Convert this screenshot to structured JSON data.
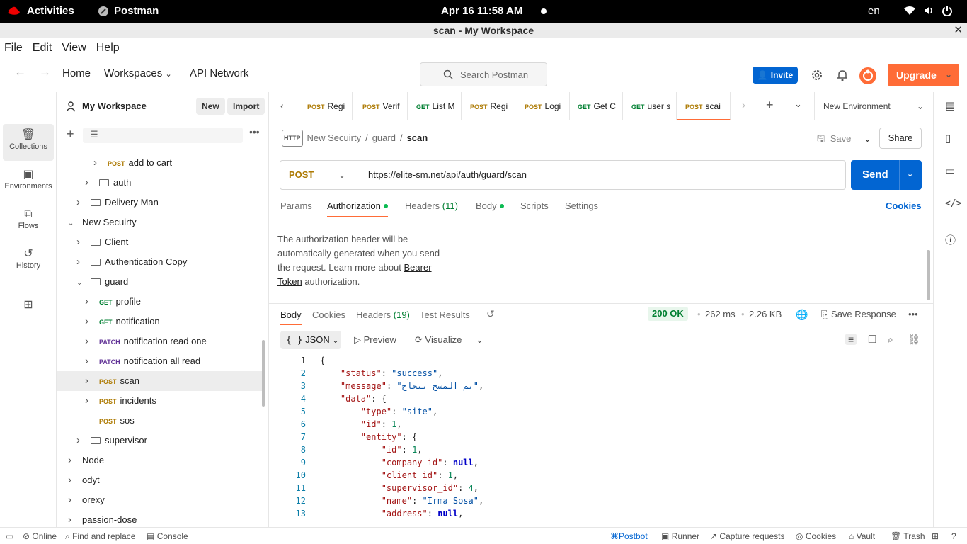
{
  "system": {
    "activities": "Activities",
    "app_name": "Postman",
    "clock": "Apr 16  11:58 AM",
    "lang": "en"
  },
  "window": {
    "title": "scan - My Workspace"
  },
  "menu": [
    "File",
    "Edit",
    "View",
    "Help"
  ],
  "header": {
    "home": "Home",
    "workspaces": "Workspaces",
    "api_network": "API Network",
    "search_placeholder": "Search Postman",
    "invite": "Invite",
    "upgrade": "Upgrade"
  },
  "rail": [
    {
      "label": "Collections",
      "icon": "collections-icon"
    },
    {
      "label": "Environments",
      "icon": "environments-icon"
    },
    {
      "label": "Flows",
      "icon": "flows-icon"
    },
    {
      "label": "History",
      "icon": "history-icon"
    }
  ],
  "sidebar": {
    "workspace_name": "My Workspace",
    "new_label": "New",
    "import_label": "Import",
    "tree": [
      {
        "indent": 3,
        "chev": true,
        "method": "POST",
        "label": "add to cart"
      },
      {
        "indent": 2,
        "chev": true,
        "folder": true,
        "label": "auth"
      },
      {
        "indent": 1,
        "chev": true,
        "folder": true,
        "label": "Delivery Man"
      },
      {
        "indent": 0,
        "chev": true,
        "open": true,
        "label": "New Secuirty"
      },
      {
        "indent": 1,
        "chev": true,
        "folder": true,
        "label": "Client"
      },
      {
        "indent": 1,
        "chev": true,
        "folder": true,
        "label": "Authentication Copy"
      },
      {
        "indent": 1,
        "chev": true,
        "open": true,
        "folder": true,
        "label": "guard"
      },
      {
        "indent": 2,
        "chev": true,
        "method": "GET",
        "label": "profile"
      },
      {
        "indent": 2,
        "chev": true,
        "method": "GET",
        "label": "notification"
      },
      {
        "indent": 2,
        "chev": true,
        "method": "PATCH",
        "label": "notification read one"
      },
      {
        "indent": 2,
        "chev": true,
        "method": "PATCH",
        "label": "notification all read"
      },
      {
        "indent": 2,
        "chev": true,
        "method": "POST",
        "label": "scan",
        "selected": true
      },
      {
        "indent": 2,
        "chev": true,
        "method": "POST",
        "label": "incidents"
      },
      {
        "indent": 2,
        "chev": false,
        "method": "POST",
        "label": "sos"
      },
      {
        "indent": 1,
        "chev": true,
        "folder": true,
        "label": "supervisor"
      },
      {
        "indent": 0,
        "chev": true,
        "label": "Node"
      },
      {
        "indent": 0,
        "chev": true,
        "label": "odyt"
      },
      {
        "indent": 0,
        "chev": true,
        "label": "orexy"
      },
      {
        "indent": 0,
        "chev": true,
        "label": "passion-dose"
      }
    ]
  },
  "tabs": [
    {
      "method": "POST",
      "label": "Regi"
    },
    {
      "method": "POST",
      "label": "Verif"
    },
    {
      "method": "GET",
      "label": "List M"
    },
    {
      "method": "POST",
      "label": "Regi"
    },
    {
      "method": "POST",
      "label": "Logi"
    },
    {
      "method": "GET",
      "label": "Get C"
    },
    {
      "method": "GET",
      "label": "user s"
    },
    {
      "method": "POST",
      "label": "scai",
      "active": true
    }
  ],
  "environment": "New Environment",
  "request": {
    "breadcrumb": [
      "New Secuirty",
      "guard",
      "scan"
    ],
    "save": "Save",
    "share": "Share",
    "method": "POST",
    "url": "https://elite-sm.net/api/auth/guard/scan",
    "send": "Send",
    "tabs": {
      "params": "Params",
      "authorization": "Authorization",
      "headers": "Headers",
      "headers_count": "(11)",
      "body": "Body",
      "scripts": "Scripts",
      "settings": "Settings",
      "cookies": "Cookies"
    },
    "auth_text": "The authorization header will be automatically generated when you send the request. Learn more about",
    "auth_link": "Bearer Token",
    "auth_suffix": "authorization."
  },
  "response": {
    "tabs": {
      "body": "Body",
      "cookies": "Cookies",
      "headers": "Headers",
      "headers_count": "(19)",
      "test_results": "Test Results"
    },
    "status": "200 OK",
    "time": "262 ms",
    "size": "2.26 KB",
    "save_response": "Save Response",
    "format": "JSON",
    "preview": "Preview",
    "visualize": "Visualize",
    "lines": [
      "{",
      "    \"status\": \"success\",",
      "    \"message\": \"تم المسح بنجاح\",",
      "    \"data\": {",
      "        \"type\": \"site\",",
      "        \"id\": 1,",
      "        \"entity\": {",
      "            \"id\": 1,",
      "            \"company_id\": null,",
      "            \"client_id\": 1,",
      "            \"supervisor_id\": 4,",
      "            \"name\": \"Irma Sosa\",",
      "            \"address\": null,"
    ]
  },
  "footer": {
    "online": "Online",
    "find_replace": "Find and replace",
    "console": "Console",
    "postbot": "Postbot",
    "runner": "Runner",
    "capture": "Capture requests",
    "cookies": "Cookies",
    "vault": "Vault",
    "trash": "Trash"
  }
}
